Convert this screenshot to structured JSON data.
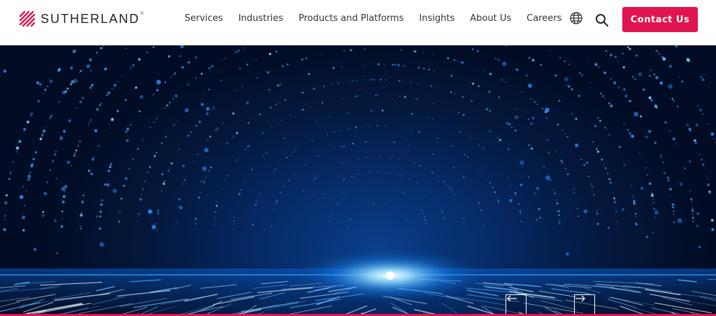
{
  "brand": {
    "name": "SUTHERLAND",
    "registered": "®",
    "accent_color": "#e0144f"
  },
  "nav": {
    "items": [
      {
        "label": "Services"
      },
      {
        "label": "Industries"
      },
      {
        "label": "Products and Platforms"
      },
      {
        "label": "Insights"
      },
      {
        "label": "About Us"
      },
      {
        "label": "Careers"
      }
    ]
  },
  "header_icons": {
    "globe": "globe-icon",
    "search": "search-icon"
  },
  "cta": {
    "label": "Contact Us"
  },
  "hero": {
    "image": "blue particle tunnel with light burst",
    "prev_icon": "arrow-left-icon",
    "next_icon": "arrow-right-icon"
  }
}
